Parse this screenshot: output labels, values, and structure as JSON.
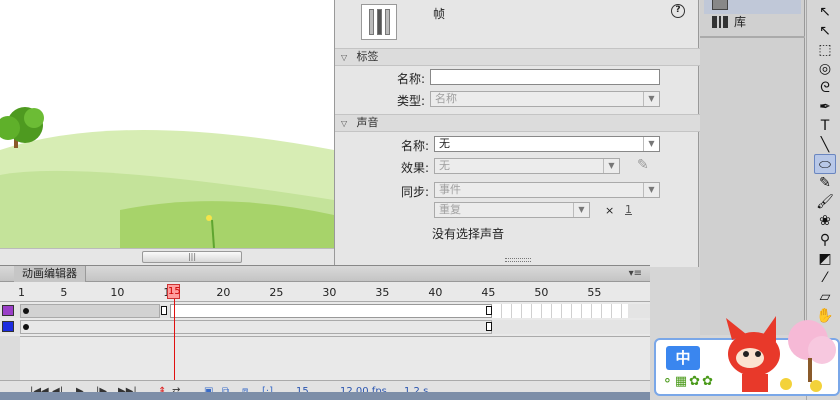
{
  "properties": {
    "frame_label": "帧",
    "help_icon": "?",
    "sections": {
      "label": "标签",
      "sound": "声音"
    },
    "label_section": {
      "name_label": "名称:",
      "name_value": "",
      "type_label": "类型:",
      "type_value": "名称"
    },
    "sound_section": {
      "name_label": "名称:",
      "name_value": "无",
      "effect_label": "效果:",
      "effect_value": "无",
      "sync_label": "同步:",
      "sync_value": "事件",
      "repeat_value": "重复",
      "repeat_times_prefix": "×",
      "repeat_times": "1",
      "status": "没有选择声音"
    }
  },
  "library_panel": {
    "tabs": [
      {
        "label": "",
        "icon": "properties-icon"
      },
      {
        "label": "库",
        "icon": "library-icon"
      }
    ]
  },
  "tools": [
    {
      "name": "selection-tool",
      "glyph": "↖"
    },
    {
      "name": "subselection-tool",
      "glyph": "↖"
    },
    {
      "name": "free-transform-tool",
      "glyph": "⬚"
    },
    {
      "name": "3d-rotation-tool",
      "glyph": "◎"
    },
    {
      "name": "lasso-tool",
      "glyph": "ᘓ"
    },
    {
      "name": "pen-tool",
      "glyph": "✒"
    },
    {
      "name": "text-tool",
      "glyph": "T"
    },
    {
      "name": "line-tool",
      "glyph": "╲"
    },
    {
      "name": "oval-tool",
      "glyph": "⬭"
    },
    {
      "name": "pencil-tool",
      "glyph": "✎"
    },
    {
      "name": "brush-tool",
      "glyph": "🖌"
    },
    {
      "name": "deco-tool",
      "glyph": "❀"
    },
    {
      "name": "bone-tool",
      "glyph": "⚲"
    },
    {
      "name": "paint-bucket-tool",
      "glyph": "◩"
    },
    {
      "name": "eyedropper-tool",
      "glyph": "⁄"
    },
    {
      "name": "eraser-tool",
      "glyph": "▱"
    },
    {
      "name": "hand-tool",
      "glyph": "✋"
    }
  ],
  "timeline": {
    "tab_label": "动画编辑器",
    "menu_icon": "▾≡",
    "ruler_labels": [
      "1",
      "5",
      "10",
      "15",
      "20",
      "25",
      "30",
      "35",
      "40",
      "45",
      "50",
      "55"
    ],
    "playhead_frame": "15",
    "layers": [
      {
        "color": "#9a3fc8"
      },
      {
        "color": "#1c2ce0"
      }
    ],
    "controls": [
      "|◀◀",
      "◀|",
      "▶",
      "|▶",
      "▶▶|"
    ],
    "current_frame": "15",
    "fps": "12.00 fps",
    "time": "1.2 s"
  },
  "ime": {
    "mode_key": "中",
    "tools_glyphs": "⚬▦✿✿"
  },
  "colors": {
    "sky": "#ffffff",
    "grass_light": "#c7e59b",
    "grass_dark": "#8cc63f",
    "playhead": "#e01010",
    "ime_blue": "#3a86ef"
  }
}
